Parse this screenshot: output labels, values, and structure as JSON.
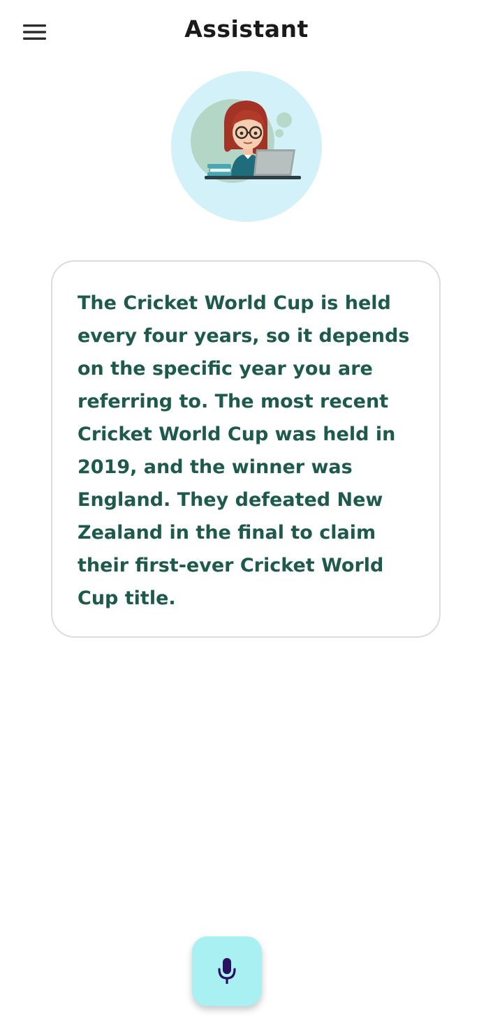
{
  "app_bar": {
    "title": "Assistant",
    "menu_icon": "hamburger-menu-icon"
  },
  "avatar": {
    "description_icon": "assistant-avatar-icon"
  },
  "response": {
    "text": "The Cricket World Cup is held every four years, so it depends on the specific year you are referring to. The most recent Cricket World Cup was held in 2019, and the winner was England. They defeated New Zealand in the final to claim their first-ever Cricket World Cup title."
  },
  "mic": {
    "icon": "microphone-icon"
  },
  "colors": {
    "text_green": "#1e5a4c",
    "avatar_bg": "#d3f1f8",
    "mic_button_bg": "#a9f0f3",
    "mic_icon": "#2a1060"
  }
}
